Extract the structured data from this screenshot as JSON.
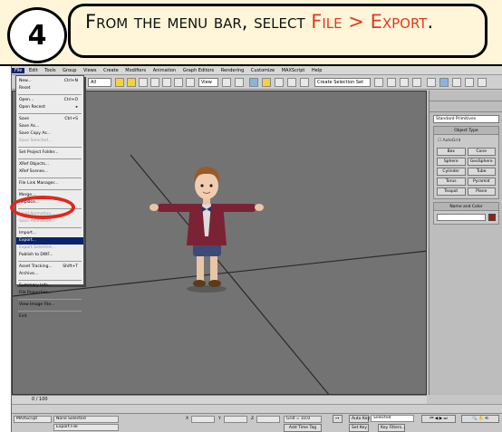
{
  "tutorial": {
    "step_number": "4",
    "instruction_prefix": "From the menu bar, select ",
    "instruction_highlight": "File > Export",
    "instruction_suffix": ".",
    "highlight_color": "#e03a1f"
  },
  "app": {
    "menubar": [
      "File",
      "Edit",
      "Tools",
      "Group",
      "Views",
      "Create",
      "Modifiers",
      "Animation",
      "Graph Editors",
      "Rendering",
      "Customize",
      "MAXScript",
      "Help"
    ],
    "toolbar_dropdown": "All",
    "view_dropdown": "View",
    "selection_set": "Create Selection Set"
  },
  "file_menu": {
    "items": [
      {
        "label": "New...",
        "shortcut": "Ctrl+N"
      },
      {
        "label": "Reset",
        "shortcut": ""
      },
      {
        "label": "Open...",
        "shortcut": "Ctrl+O"
      },
      {
        "label": "Open Recent",
        "shortcut": "▸"
      },
      {
        "label": "Save",
        "shortcut": "Ctrl+S"
      },
      {
        "label": "Save As...",
        "shortcut": ""
      },
      {
        "label": "Save Copy As...",
        "shortcut": ""
      },
      {
        "label": "Save Selected...",
        "shortcut": ""
      },
      {
        "label": "Set Project Folder...",
        "shortcut": ""
      },
      {
        "label": "XRef Objects...",
        "shortcut": ""
      },
      {
        "label": "XRef Scenes...",
        "shortcut": ""
      },
      {
        "label": "File Link Manager...",
        "shortcut": ""
      },
      {
        "label": "Merge...",
        "shortcut": ""
      },
      {
        "label": "Replace...",
        "shortcut": ""
      },
      {
        "label": "Load Animation...",
        "shortcut": ""
      },
      {
        "label": "Save Animation...",
        "shortcut": ""
      },
      {
        "label": "Import...",
        "shortcut": ""
      },
      {
        "label": "Export...",
        "shortcut": ""
      },
      {
        "label": "Export Selected...",
        "shortcut": ""
      },
      {
        "label": "Publish to DWF...",
        "shortcut": ""
      },
      {
        "label": "Asset Tracking...",
        "shortcut": "Shift+T"
      },
      {
        "label": "Archive...",
        "shortcut": ""
      },
      {
        "label": "Summary Info...",
        "shortcut": ""
      },
      {
        "label": "File Properties...",
        "shortcut": ""
      },
      {
        "label": "View Image File...",
        "shortcut": ""
      },
      {
        "label": "Exit",
        "shortcut": ""
      }
    ]
  },
  "command_panel": {
    "dropdown": "Standard Primitives",
    "object_type_title": "Object Type",
    "autogrid": "AutoGrid",
    "buttons": [
      "Box",
      "Cone",
      "Sphere",
      "GeoSphere",
      "Cylinder",
      "Tube",
      "Torus",
      "Pyramid",
      "Teapot",
      "Plane"
    ],
    "name_color_title": "Name and Color",
    "object_color": "#a41818"
  },
  "timeline": {
    "frame_label": "0 / 100"
  },
  "status": {
    "selection": "None Selected",
    "prompt": "Export File",
    "listener": "MAXScript",
    "x_label": "X",
    "y_label": "Y",
    "z_label": "Z",
    "grid": "Grid = 10.0",
    "add_time_tag": "Add Time Tag",
    "auto_key": "Auto Key",
    "auto_key_mode": "Selected",
    "set_key": "Set Key",
    "key_filters": "Key Filters..."
  }
}
